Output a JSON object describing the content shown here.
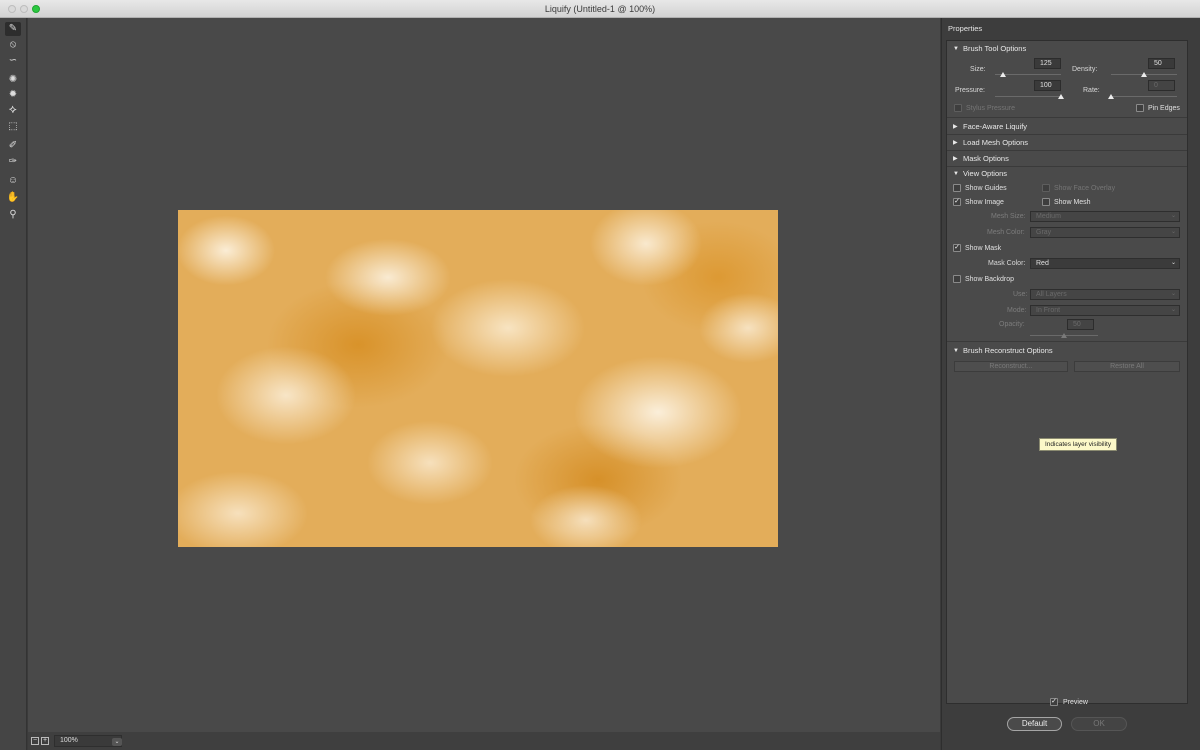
{
  "window": {
    "title": "Liquify (Untitled-1 @ 100%)"
  },
  "tools": [
    {
      "name": "forward-warp-tool-icon",
      "glyph": "✎"
    },
    {
      "name": "reconstruct-tool-icon",
      "glyph": "⦸"
    },
    {
      "name": "smooth-tool-icon",
      "glyph": "∽"
    },
    {
      "name": "twirl-clockwise-tool-icon",
      "glyph": "✺"
    },
    {
      "name": "pucker-tool-icon",
      "glyph": "✹"
    },
    {
      "name": "bloat-tool-icon",
      "glyph": "⯎"
    },
    {
      "name": "push-left-tool-icon",
      "glyph": "⬚"
    },
    {
      "name": "freeze-mask-tool-icon",
      "glyph": "✐"
    },
    {
      "name": "thaw-mask-tool-icon",
      "glyph": "✑"
    },
    {
      "name": "face-tool-icon",
      "glyph": "☺"
    },
    {
      "name": "hand-tool-icon",
      "glyph": "✋"
    },
    {
      "name": "zoom-tool-icon",
      "glyph": "⚲"
    }
  ],
  "status": {
    "zoom": "100%",
    "zoom_out": "−",
    "zoom_in": "+"
  },
  "panel": {
    "title": "Properties",
    "brush_tool_options": {
      "label": "Brush Tool Options",
      "size_label": "Size:",
      "size": "125",
      "size_fraction": 0.12,
      "density_label": "Density:",
      "density": "50",
      "density_fraction": 0.5,
      "pressure_label": "Pressure:",
      "pressure": "100",
      "pressure_fraction": 1.0,
      "rate_label": "Rate:",
      "rate": "0",
      "rate_fraction": 0.0,
      "stylus_pressure": "Stylus Pressure",
      "pin_edges": "Pin Edges"
    },
    "face_aware": "Face-Aware Liquify",
    "load_mesh": "Load Mesh Options",
    "mask_options": "Mask Options",
    "view_options": {
      "label": "View Options",
      "show_guides": "Show Guides",
      "show_face_overlay": "Show Face Overlay",
      "show_image": "Show Image",
      "show_mesh": "Show Mesh",
      "mesh_size_label": "Mesh Size:",
      "mesh_size": "Medium",
      "mesh_color_label": "Mesh Color:",
      "mesh_color": "Gray",
      "show_mask": "Show Mask",
      "mask_color_label": "Mask Color:",
      "mask_color": "Red",
      "show_backdrop": "Show Backdrop",
      "use_label": "Use:",
      "use": "All Layers",
      "mode_label": "Mode:",
      "mode": "In Front",
      "opacity_label": "Opacity:",
      "opacity": "50",
      "opacity_fraction": 0.5
    },
    "brush_reconstruct": {
      "label": "Brush Reconstruct Options",
      "reconstruct": "Reconstruct...",
      "restore_all": "Restore All"
    },
    "tooltip": "Indicates layer visibility",
    "preview": "Preview",
    "default_button": "Default",
    "ok_button": "OK"
  },
  "check": "✓",
  "tri_open": "▼",
  "tri_closed": "▶",
  "caret": "⌄"
}
